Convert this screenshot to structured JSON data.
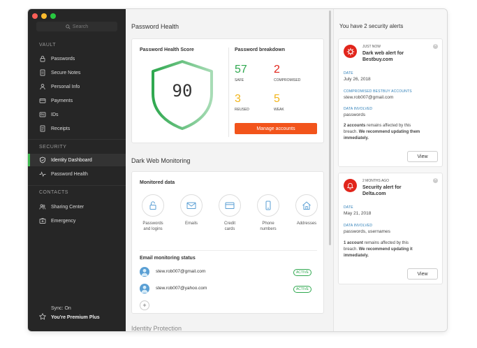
{
  "sidebar": {
    "search_placeholder": "Search",
    "sections": {
      "vault": "VAULT",
      "security": "SECURITY",
      "contacts": "CONTACTS"
    },
    "vault_items": [
      {
        "label": "Passwords",
        "icon": "lock-icon"
      },
      {
        "label": "Secure Notes",
        "icon": "note-icon"
      },
      {
        "label": "Personal Info",
        "icon": "person-icon"
      },
      {
        "label": "Payments",
        "icon": "card-icon"
      },
      {
        "label": "IDs",
        "icon": "id-icon"
      },
      {
        "label": "Receipts",
        "icon": "receipt-icon"
      }
    ],
    "security_items": [
      {
        "label": "Identity Dashboard",
        "icon": "shield-icon",
        "active": true
      },
      {
        "label": "Password Health",
        "icon": "pulse-icon",
        "active": false
      }
    ],
    "contact_items": [
      {
        "label": "Sharing Center",
        "icon": "people-icon"
      },
      {
        "label": "Emergency",
        "icon": "emergency-icon"
      }
    ],
    "sync": "Sync: On",
    "premium": "You're Premium Plus"
  },
  "main": {
    "password_health_title": "Password Health",
    "score_label": "Password Health Score",
    "score_value": "90",
    "breakdown_label": "Password breakdown",
    "breakdown": [
      {
        "value": "57",
        "label": "SAFE",
        "color": "#2fa84f"
      },
      {
        "value": "2",
        "label": "COMPROMISED",
        "color": "#e1251b"
      },
      {
        "value": "3",
        "label": "REUSED",
        "color": "#f2b51c"
      },
      {
        "value": "5",
        "label": "WEAK",
        "color": "#f2b51c"
      }
    ],
    "manage_button": "Manage accounts",
    "dark_web_title": "Dark Web Monitoring",
    "monitored_label": "Monitored data",
    "monitored": [
      {
        "label1": "Passwords",
        "label2": "and logins",
        "icon": "lock-icon"
      },
      {
        "label1": "Emails",
        "label2": "",
        "icon": "mail-icon"
      },
      {
        "label1": "Credit",
        "label2": "cards",
        "icon": "card-icon"
      },
      {
        "label1": "Phone",
        "label2": "numbers",
        "icon": "phone-icon"
      },
      {
        "label1": "Addresses",
        "label2": "",
        "icon": "home-icon"
      }
    ],
    "email_status_label": "Email monitoring status",
    "emails": [
      {
        "address": "stew.rob007@gmail.com",
        "status": "ACTIVE"
      },
      {
        "address": "stew.rob007@yahoo.com",
        "status": "ACTIVE"
      }
    ],
    "add_label": "+",
    "identity_protection": "Identity Protection"
  },
  "alerts": {
    "header": "You have 2 security alerts",
    "items": [
      {
        "time": "JUST NOW",
        "title1": "Dark web alert for",
        "title2": "Bestbuy.com",
        "date_label": "DATE",
        "date": "July 26, 2018",
        "accounts_label": "COMPROMISED BESTBUY ACCOUNTS",
        "accounts": "stew.rob007@gmail.com",
        "data_label": "DATA INVOLVED",
        "data": "passwords",
        "msg_bold": "2 accounts",
        "msg1": " remains affected by this",
        "msg2": "breach. ",
        "msg2_bold": "We recommend updating them",
        "msg3_bold": "immediately.",
        "button": "View",
        "icon": "virus-icon"
      },
      {
        "time": "2 MONTHS AGO",
        "title1": "Security alert for",
        "title2": "Delta.com",
        "date_label": "DATE",
        "date": "May 21, 2018",
        "data_label": "DATA INVOLVED",
        "data": "passwords, usernames",
        "msg_bold": "1 account",
        "msg1": " remains affected by this",
        "msg2": "breach. ",
        "msg2_bold": "We recommend updating it",
        "msg3_bold": "immediately.",
        "button": "View",
        "icon": "bell-icon"
      }
    ]
  },
  "colors": {
    "accent_red": "#e1251b",
    "accent_green": "#2fa84f",
    "manage_orange": "#f2541b",
    "sidebar_bg": "#262626"
  }
}
